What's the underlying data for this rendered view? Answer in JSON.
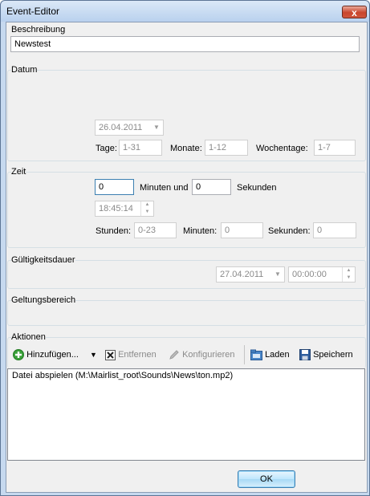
{
  "window": {
    "title": "Event-Editor",
    "close_glyph": "x"
  },
  "beschreibung": {
    "label": "Beschreibung",
    "value": "Newstest"
  },
  "datum": {
    "label": "Datum",
    "date_value": "26.04.2011",
    "tage_label": "Tage:",
    "tage_value": "1-31",
    "monate_label": "Monate:",
    "monate_value": "1-12",
    "wochentage_label": "Wochentage:",
    "wochentage_value": "1-7"
  },
  "zeit": {
    "label": "Zeit",
    "minuten_value": "0",
    "minuten_und_label": "Minuten und",
    "sekunden_value": "0",
    "sekunden_label": "Sekunden",
    "time_value": "18:45:14",
    "stunden_label": "Stunden:",
    "stunden_value": "0-23",
    "minuten_label": "Minuten:",
    "minuten2_value": "0",
    "sekunden2_label": "Sekunden:",
    "sekunden2_value": "0"
  },
  "gueltigkeit": {
    "label": "Gültigkeitsdauer",
    "date_value": "27.04.2011",
    "time_value": "00:00:00"
  },
  "geltungsbereich": {
    "label": "Geltungsbereich"
  },
  "aktionen": {
    "label": "Aktionen",
    "toolbar": {
      "add_label": "Hinzufügen...",
      "remove_label": "Entfernen",
      "configure_label": "Konfigurieren",
      "load_label": "Laden",
      "save_label": "Speichern"
    },
    "items": [
      "Datei abspielen (M:\\Mairlist_root\\Sounds\\News\\ton.mp2)"
    ]
  },
  "buttons": {
    "ok_label": "OK"
  },
  "colors": {
    "accent": "#3c7fb1",
    "close": "#c9452c",
    "add_icon": "#3aa13a"
  }
}
